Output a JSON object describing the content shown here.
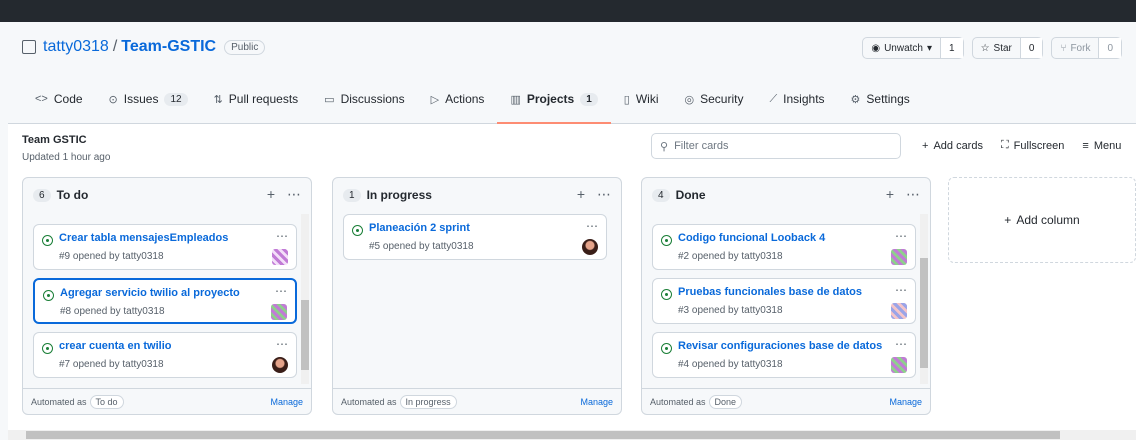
{
  "repo": {
    "owner": "tatty0318",
    "name": "Team-GSTIC",
    "visibility": "Public"
  },
  "repo_actions": {
    "watch_label": "Unwatch",
    "watch_count": "1",
    "star_label": "Star",
    "star_count": "0",
    "fork_label": "Fork",
    "fork_count": "0"
  },
  "tabs": [
    {
      "label": "Code",
      "icon": "code-icon"
    },
    {
      "label": "Issues",
      "count": "12",
      "icon": "issue-icon"
    },
    {
      "label": "Pull requests",
      "icon": "pull-request-icon"
    },
    {
      "label": "Discussions",
      "icon": "discussion-icon"
    },
    {
      "label": "Actions",
      "icon": "play-icon"
    },
    {
      "label": "Projects",
      "count": "1",
      "icon": "project-icon",
      "active": true
    },
    {
      "label": "Wiki",
      "icon": "book-icon"
    },
    {
      "label": "Security",
      "icon": "shield-icon"
    },
    {
      "label": "Insights",
      "icon": "graph-icon"
    },
    {
      "label": "Settings",
      "icon": "gear-icon"
    }
  ],
  "project": {
    "name": "Team GSTIC",
    "updated": "Updated 1 hour ago"
  },
  "filter": {
    "placeholder": "Filter cards"
  },
  "project_actions": {
    "add_cards": "Add cards",
    "fullscreen": "Fullscreen",
    "menu": "Menu"
  },
  "columns": [
    {
      "count": "6",
      "title": "To do",
      "automated_as": "Automated as",
      "automation": "To do",
      "manage": "Manage",
      "cards": [
        {
          "title": "Crear tabla mensajesEmpleados",
          "sub": "#9 opened by tatty0318"
        },
        {
          "title": "Agregar servicio twilio al proyecto",
          "sub": "#8 opened by tatty0318"
        },
        {
          "title": "crear cuenta en twilio",
          "sub": "#7 opened by tatty0318"
        }
      ]
    },
    {
      "count": "1",
      "title": "In progress",
      "automated_as": "Automated as",
      "automation": "In progress",
      "manage": "Manage",
      "cards": [
        {
          "title": "Planeación 2 sprint",
          "sub": "#5 opened by tatty0318"
        }
      ]
    },
    {
      "count": "4",
      "title": "Done",
      "automated_as": "Automated as",
      "automation": "Done",
      "manage": "Manage",
      "cards": [
        {
          "title": "Codigo funcional Looback 4",
          "sub": "#2 opened by tatty0318"
        },
        {
          "title": "Pruebas funcionales base de datos",
          "sub": "#3 opened by tatty0318"
        },
        {
          "title": "Revisar configuraciones base de datos",
          "sub": "#4 opened by tatty0318"
        }
      ]
    }
  ],
  "add_column": "Add column",
  "colors": {
    "link": "#0969da",
    "open_issue": "#1a7f37",
    "active_tab": "#fd8c73"
  }
}
